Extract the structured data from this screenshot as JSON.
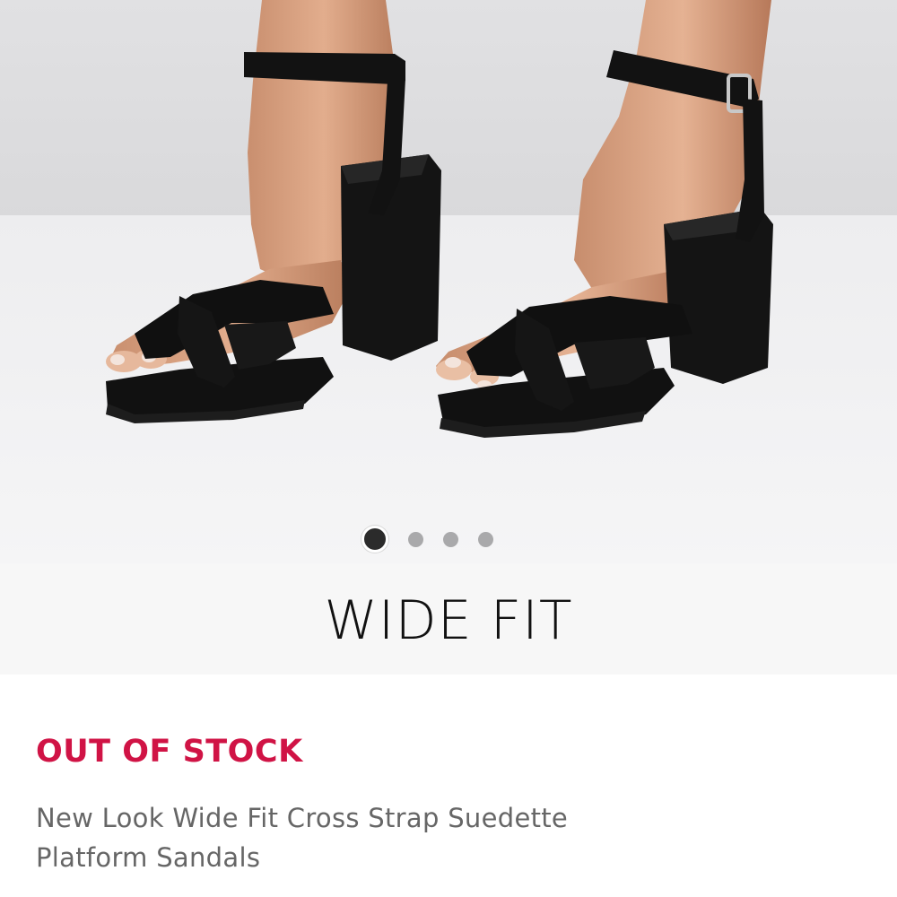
{
  "gallery": {
    "image_alt": "Black cross strap platform block heel sandals worn on feet",
    "dots": [
      {
        "active": true
      },
      {
        "active": false
      },
      {
        "active": false
      },
      {
        "active": false
      }
    ]
  },
  "banner": {
    "title": "WIDE FIT"
  },
  "product": {
    "stock_status": "OUT OF STOCK",
    "name": "New Look Wide Fit Cross Strap Suedette Platform Sandals"
  },
  "colors": {
    "stock_status": "#d01345",
    "product_name": "#666666",
    "banner_bg": "#f7f7f7",
    "dot_active": "#2b2b2b",
    "dot_inactive": "#a9a9ab"
  }
}
